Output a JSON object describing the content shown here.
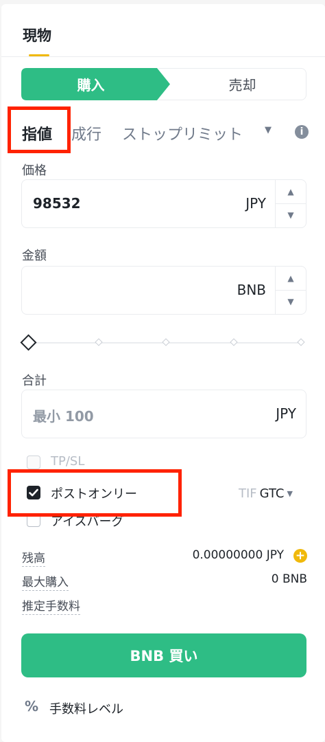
{
  "tabs": {
    "active": "現物"
  },
  "side": {
    "buy": "購入",
    "sell": "売却"
  },
  "order_types": {
    "limit": "指値",
    "market": "成行",
    "stop_limit": "ストップリミット"
  },
  "price": {
    "label": "価格",
    "value": "98532",
    "unit": "JPY"
  },
  "amount": {
    "label": "金額",
    "value": "",
    "unit": "BNB"
  },
  "total": {
    "label": "合計",
    "placeholder": "最小 100",
    "unit": "JPY"
  },
  "slider": {
    "value_percent": 0
  },
  "options": {
    "tpsl": {
      "label": "TP/SL",
      "checked": false,
      "disabled": true
    },
    "post_only": {
      "label": "ポストオンリー",
      "checked": true
    },
    "iceberg": {
      "label": "アイスバーグ",
      "checked": false
    }
  },
  "tif": {
    "label": "TIF",
    "value": "GTC"
  },
  "balances": {
    "balance": {
      "label": "残高",
      "value": "0.00000000 JPY"
    },
    "max_buy": {
      "label": "最大購入",
      "value": "0 BNB"
    },
    "est_fee": {
      "label": "推定手数料"
    }
  },
  "submit": {
    "label": "BNB 買い"
  },
  "fee_level": {
    "label": "手数料レベル"
  },
  "colors": {
    "buy_green": "#2ebd85",
    "accent_yellow": "#f0b90b",
    "highlight_red": "#ff2200"
  }
}
